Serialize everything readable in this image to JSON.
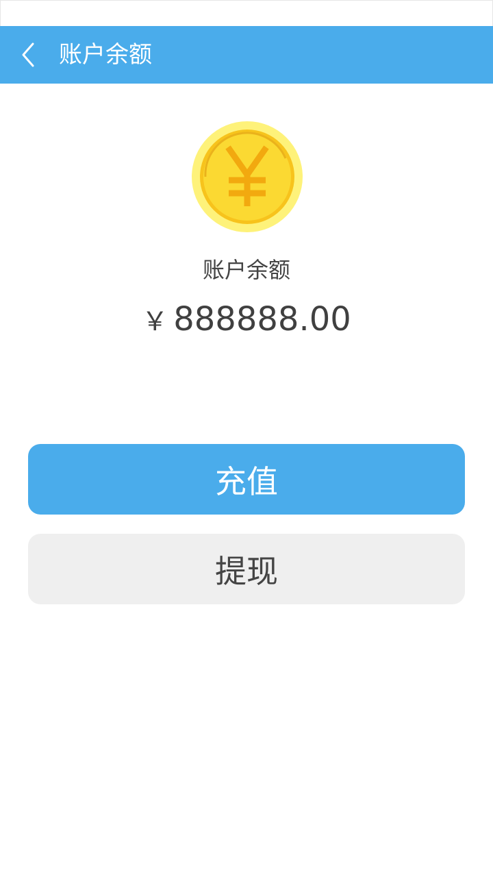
{
  "header": {
    "title": "账户余额",
    "back_icon": "chevron-left-icon",
    "background": "#4aaceb"
  },
  "balance": {
    "icon": "yuan-coin-icon",
    "label": "账户余额",
    "currency_symbol": "￥",
    "amount": "888888.00"
  },
  "actions": {
    "recharge_label": "充值",
    "withdraw_label": "提现",
    "primary_color": "#4aaceb",
    "secondary_color": "#efefef"
  }
}
